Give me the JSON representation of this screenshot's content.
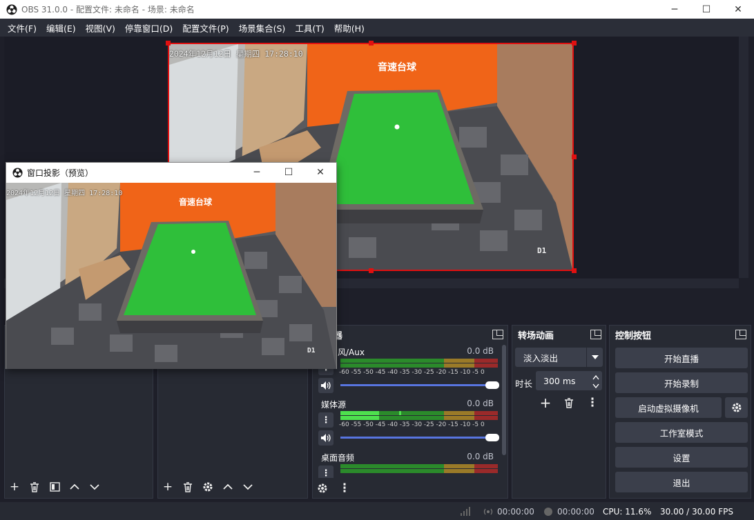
{
  "window": {
    "title": "OBS 31.0.0 - 配置文件: 未命名 - 场景: 未命名",
    "minimize": "─",
    "maximize": "☐",
    "close": "✕"
  },
  "menu": [
    "文件(F)",
    "编辑(E)",
    "视图(V)",
    "停靠窗口(D)",
    "配置文件(P)",
    "场景集合(S)",
    "工具(T)",
    "帮助(H)"
  ],
  "preview": {
    "timestamp": "2024年12月12日 星期四 17:28:10",
    "camera_label": "D1",
    "venue_sign": "音速台球"
  },
  "projector": {
    "title": "窗口投影（预览）",
    "timestamp": "2024年12月12日 星期四 17:28:10",
    "camera_label": "D1",
    "venue_sign": "音速台球"
  },
  "mixer": {
    "title_partial": "器",
    "channels": [
      {
        "name": "风/Aux",
        "db": "0.0 dB"
      },
      {
        "name": "媒体源",
        "db": "0.0 dB"
      },
      {
        "name": "桌面音频",
        "db": "0.0 dB"
      }
    ],
    "scale": "-60 -55 -50 -45 -40 -35 -30 -25 -20 -15 -10 -5 0"
  },
  "transitions": {
    "title": "转场动画",
    "selected": "淡入淡出",
    "duration_label": "时长",
    "duration_value": "300 ms"
  },
  "controls": {
    "title": "控制按钮",
    "start_stream": "开始直播",
    "start_record": "开始录制",
    "virtual_cam": "启动虚拟摄像机",
    "studio_mode": "工作室模式",
    "settings": "设置",
    "exit": "退出"
  },
  "status": {
    "stream_time": "00:00:00",
    "record_time": "00:00:00",
    "cpu": "CPU: 11.6%",
    "fps": "30.00 / 30.00 FPS"
  },
  "colors": {
    "accent_red": "#e01010",
    "felt_green": "#2fbf3a",
    "wall_orange": "#f06418"
  }
}
